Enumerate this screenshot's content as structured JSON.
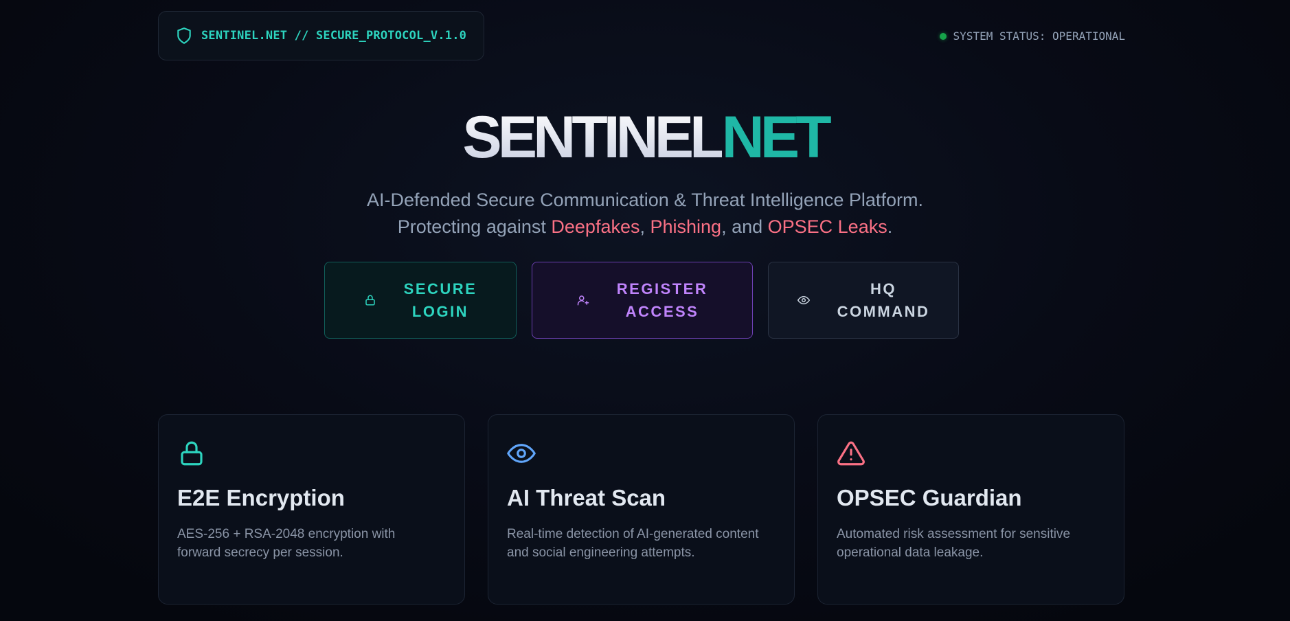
{
  "header": {
    "brand": "SENTINEL.NET // SECURE_PROTOCOL_V.1.0",
    "status": "SYSTEM STATUS: OPERATIONAL"
  },
  "hero": {
    "title_part1": "SENTINEL",
    "title_part2": "NET",
    "subtitle_line1": "AI-Defended Secure Communication & Threat Intelligence Platform.",
    "subtitle_line2_prefix": "Protecting against ",
    "threat1": "Deepfakes",
    "sep1": ", ",
    "threat2": "Phishing",
    "sep2": ", and ",
    "threat3": "OPSEC Leaks",
    "end": "."
  },
  "actions": {
    "login_line1": "SECURE",
    "login_line2": "LOGIN",
    "register_line1": "REGISTER",
    "register_line2": "ACCESS",
    "hq_line1": "HQ",
    "hq_line2": "COMMAND"
  },
  "features": [
    {
      "icon": "lock-icon",
      "title": "E2E Encryption",
      "description": "AES-256 + RSA-2048 encryption with forward secrecy per session."
    },
    {
      "icon": "eye-icon",
      "title": "AI Threat Scan",
      "description": "Real-time detection of AI-generated content and social engineering attempts."
    },
    {
      "icon": "alert-triangle-icon",
      "title": "OPSEC Guardian",
      "description": "Automated risk assessment for sensitive operational data leakage."
    }
  ],
  "colors": {
    "accent_teal": "#2dd4bf",
    "accent_purple": "#c084fc",
    "accent_red": "#fb7185",
    "status_green": "#16a34a",
    "background": "#05070f"
  }
}
